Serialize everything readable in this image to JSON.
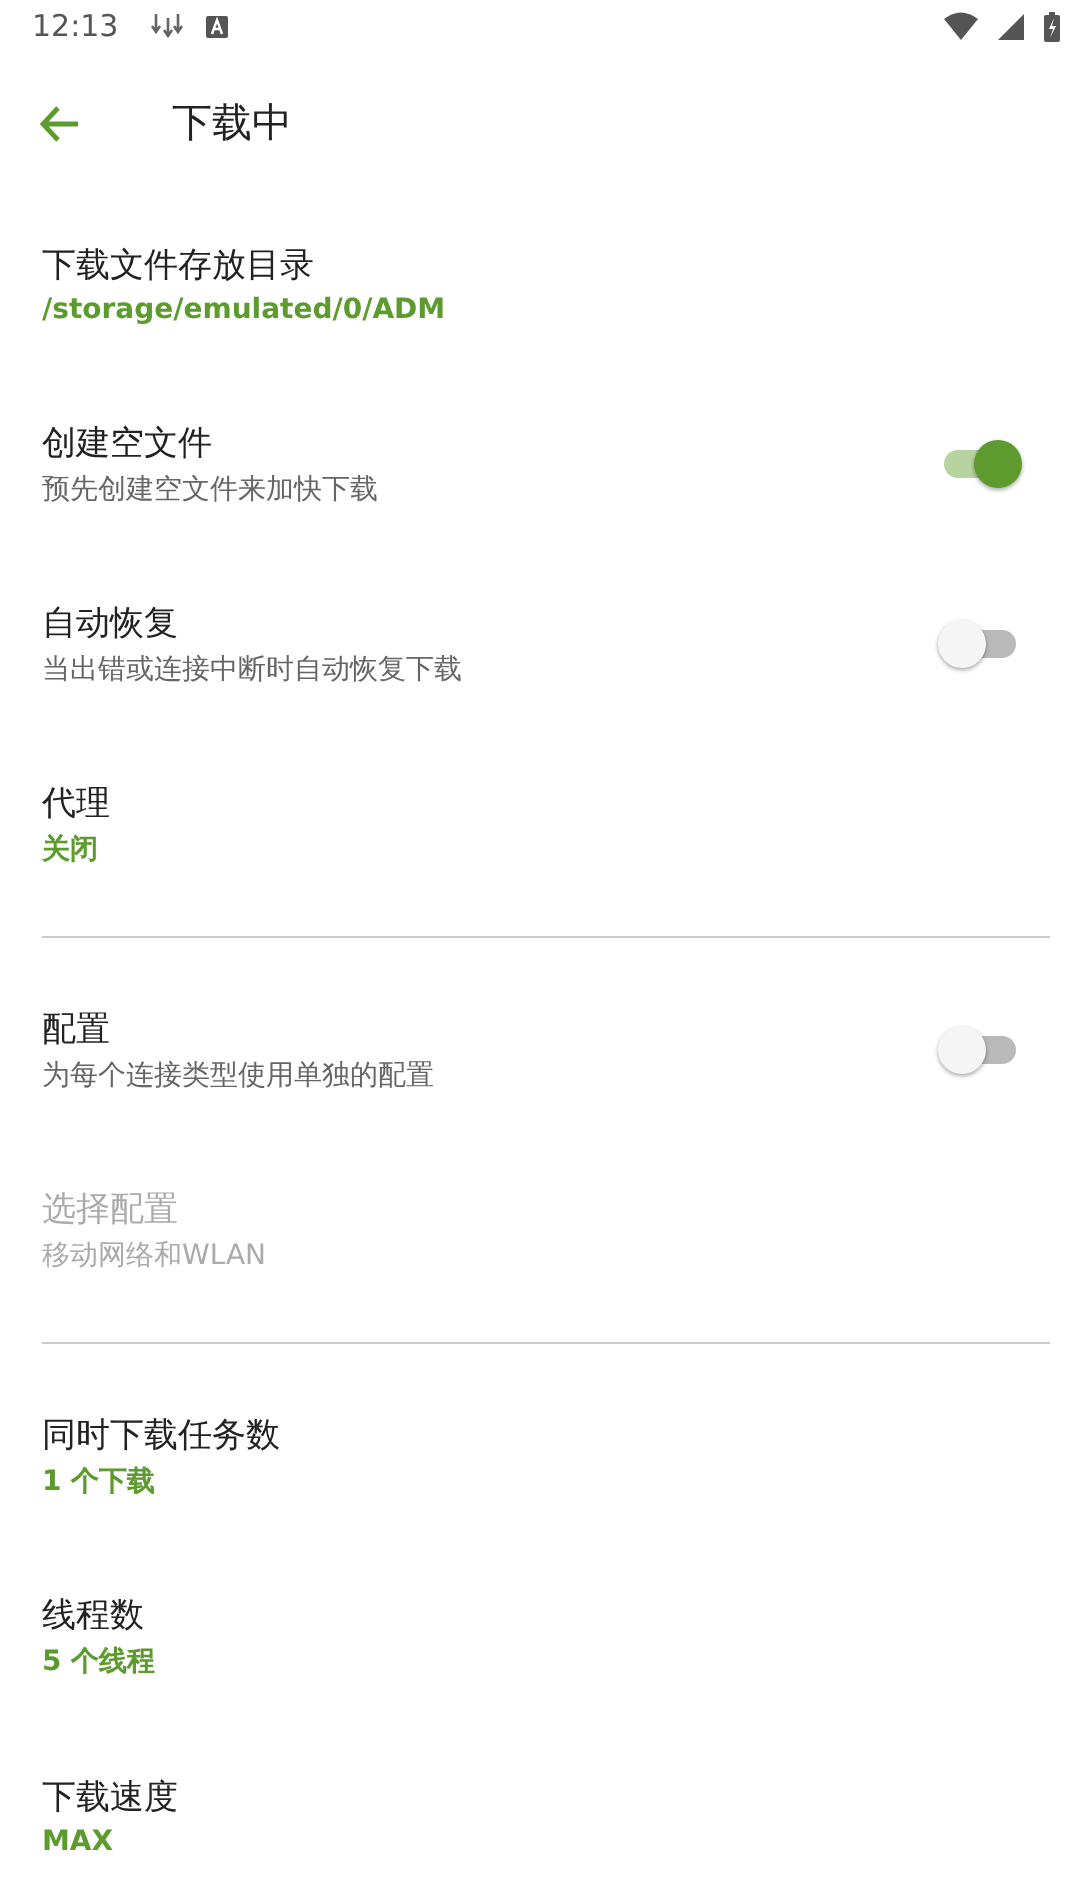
{
  "status_bar": {
    "time": "12:13"
  },
  "toolbar": {
    "title": "下载中"
  },
  "items": [
    {
      "kind": "value",
      "title": "下载文件存放目录",
      "summary": "/storage/emulated/0/ADM",
      "disabled": false
    },
    {
      "kind": "toggle",
      "title": "创建空文件",
      "summary": "预先创建空文件来加快下载",
      "on": true,
      "disabled": false
    },
    {
      "kind": "toggle",
      "title": "自动恢复",
      "summary": "当出错或连接中断时自动恢复下载",
      "on": false,
      "disabled": false
    },
    {
      "kind": "value",
      "title": "代理",
      "summary": "关闭",
      "disabled": false
    },
    {
      "kind": "divider"
    },
    {
      "kind": "toggle",
      "title": "配置",
      "summary": "为每个连接类型使用单独的配置",
      "on": false,
      "disabled": false
    },
    {
      "kind": "plain",
      "title": "选择配置",
      "summary": "移动网络和WLAN",
      "disabled": true
    },
    {
      "kind": "divider"
    },
    {
      "kind": "value",
      "title": "同时下载任务数",
      "summary": "1 个下载",
      "disabled": false
    },
    {
      "kind": "value",
      "title": "线程数",
      "summary": "5 个线程",
      "disabled": false
    },
    {
      "kind": "value",
      "title": "下载速度",
      "summary": "MAX",
      "disabled": false
    }
  ]
}
